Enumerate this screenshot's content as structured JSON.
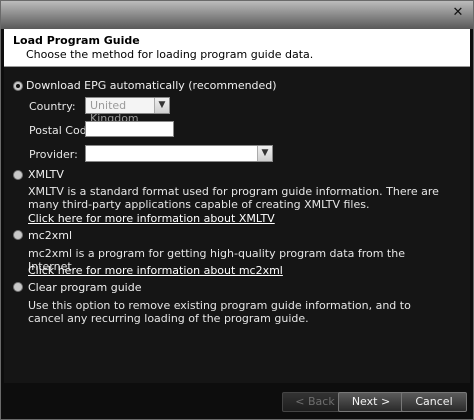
{
  "window": {
    "close_glyph": "✕"
  },
  "header": {
    "title": "Load Program Guide",
    "subtitle": "Choose the method for loading program guide data."
  },
  "options": {
    "epg": {
      "label": "Download EPG automatically (recommended)",
      "selected": true,
      "country_label": "Country:",
      "country_value": "United Kingdom",
      "postal_label": "Postal Code:",
      "postal_value": "",
      "provider_label": "Provider:",
      "provider_value": ""
    },
    "xmltv": {
      "label": "XMLTV",
      "description": "XMLTV is a standard format used for program guide information.  There are many third-party applications capable of creating XMLTV files.",
      "link": "Click here for more information about XMLTV"
    },
    "mc2xml": {
      "label": "mc2xml",
      "description": "mc2xml is a program for getting high-quality program data from the Internet.",
      "link": "Click here for more information about mc2xml"
    },
    "clear": {
      "label": "Clear program guide",
      "description": "Use this option to remove existing program guide information, and to cancel any recurring loading of the program guide."
    }
  },
  "footer": {
    "back_label": "< Back",
    "next_label": "Next >",
    "cancel_label": "Cancel"
  }
}
